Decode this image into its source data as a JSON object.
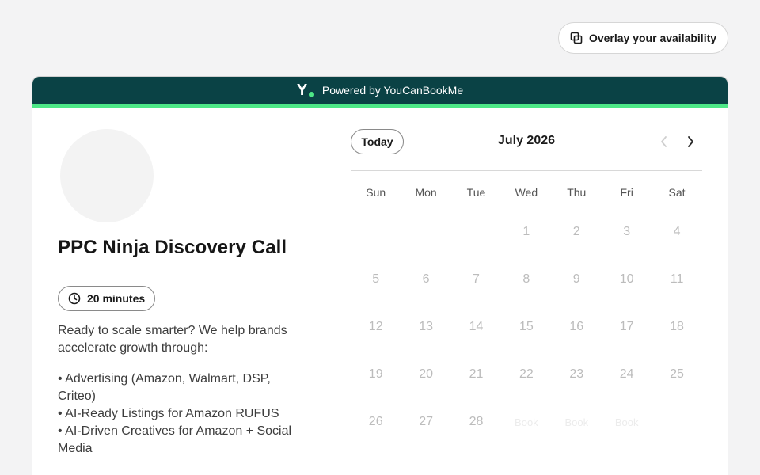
{
  "overlay": {
    "label": "Overlay your availability",
    "icon": "overlay-icon"
  },
  "banner": {
    "text": "Powered by YouCanBookMe",
    "logo_letter": "Y",
    "bg": "#0a4245",
    "accent": "#4de887"
  },
  "profile": {
    "title": "PPC Ninja Discovery Call",
    "duration": "20 minutes",
    "intro": "Ready to scale smarter? We help brands accelerate growth through:",
    "bullets": [
      "• Advertising (Amazon, Walmart, DSP, Criteo)",
      "• AI-Ready Listings for Amazon RUFUS",
      "• AI-Driven Creatives for Amazon + Social Media"
    ]
  },
  "calendar": {
    "today_label": "Today",
    "month_label": "July 2026",
    "weekdays": [
      "Sun",
      "Mon",
      "Tue",
      "Wed",
      "Thu",
      "Fri",
      "Sat"
    ],
    "weeks": [
      [
        "",
        "",
        "",
        "1",
        "2",
        "3",
        "4"
      ],
      [
        "5",
        "6",
        "7",
        "8",
        "9",
        "10",
        "11"
      ],
      [
        "12",
        "13",
        "14",
        "15",
        "16",
        "17",
        "18"
      ],
      [
        "19",
        "20",
        "21",
        "22",
        "23",
        "24",
        "25"
      ],
      [
        "26",
        "27",
        "28",
        "Book",
        "Book",
        "Book",
        ""
      ]
    ]
  }
}
